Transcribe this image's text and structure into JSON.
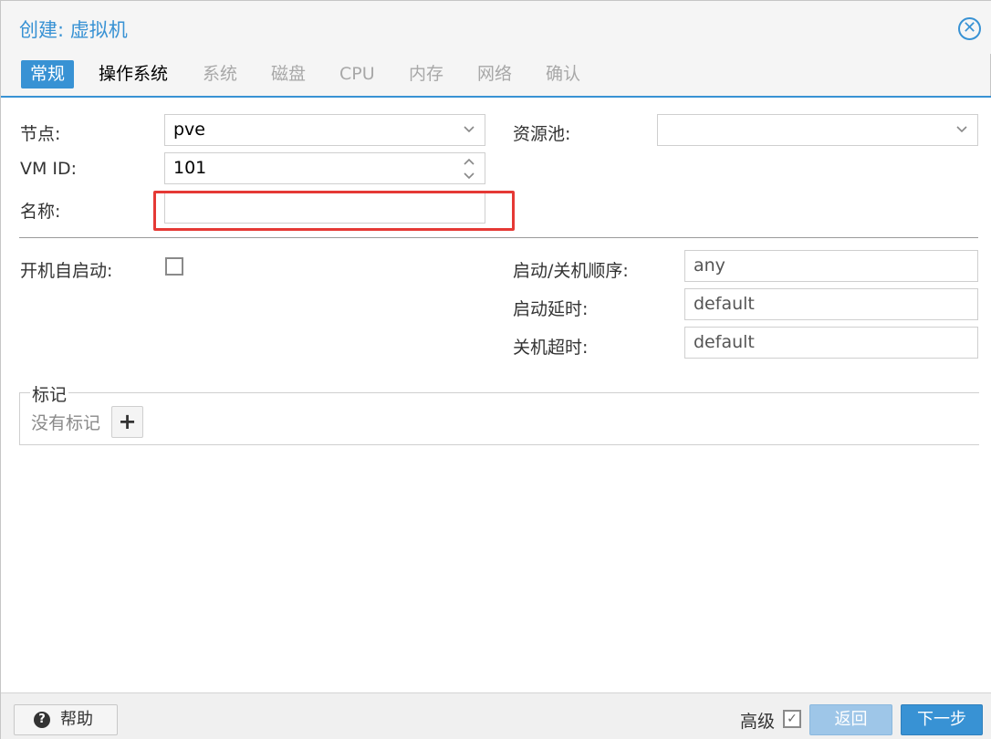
{
  "window": {
    "title": "创建: 虚拟机"
  },
  "tabs": [
    {
      "label": "常规",
      "state": "active"
    },
    {
      "label": "操作系统",
      "state": "enabled"
    },
    {
      "label": "系统",
      "state": "disabled"
    },
    {
      "label": "磁盘",
      "state": "disabled"
    },
    {
      "label": "CPU",
      "state": "disabled"
    },
    {
      "label": "内存",
      "state": "disabled"
    },
    {
      "label": "网络",
      "state": "disabled"
    },
    {
      "label": "确认",
      "state": "disabled"
    }
  ],
  "form": {
    "node_label": "节点:",
    "node_value": "pve",
    "vmid_label": "VM ID:",
    "vmid_value": "101",
    "name_label": "名称:",
    "name_value": "",
    "pool_label": "资源池:",
    "pool_value": "",
    "autostart_label": "开机自启动:",
    "autostart_checked": false,
    "order_label": "启动/关机顺序:",
    "order_value": "any",
    "delay_label": "启动延时:",
    "delay_value": "default",
    "shutdown_label": "关机超时:",
    "shutdown_value": "default"
  },
  "tags": {
    "legend": "标记",
    "empty_text": "没有标记",
    "add_icon": "plus-icon"
  },
  "footer": {
    "help_label": "帮助",
    "help_icon": "question-circle-icon",
    "advanced_label": "高级",
    "advanced_checked": true,
    "back_label": "返回",
    "next_label": "下一步"
  },
  "colors": {
    "accent": "#3892d4",
    "highlight": "#e53935",
    "disabled_button": "#9ec6e8"
  }
}
